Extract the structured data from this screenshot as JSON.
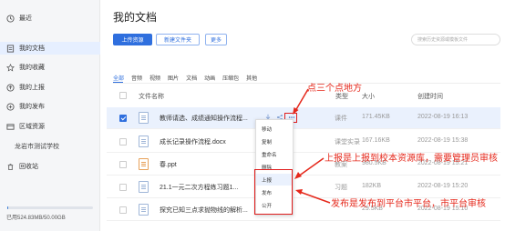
{
  "sidebar": {
    "items": [
      {
        "label": "最近",
        "icon": "clock-icon"
      },
      {
        "label": "我的文档",
        "icon": "document-icon"
      },
      {
        "label": "我的收藏",
        "icon": "star-icon"
      },
      {
        "label": "我的上报",
        "icon": "upload-report-icon"
      },
      {
        "label": "我的发布",
        "icon": "publish-icon"
      },
      {
        "label": "区域资源",
        "icon": "region-icon"
      },
      {
        "label": "龙岩市测试学校",
        "icon": ""
      },
      {
        "label": "回收站",
        "icon": "trash-icon"
      }
    ],
    "quota_text": "已用524.83MB/50.00GB",
    "quota_fraction": 0.0102
  },
  "main": {
    "title": "我的文档",
    "upload_button": "上传资源",
    "new_folder_button": "新建文件夹",
    "more_button": "更多",
    "search_placeholder": "搜索历史资源或模板文件",
    "tabs": [
      "全部",
      "音频",
      "视频",
      "图片",
      "文档",
      "动画",
      "压缩包",
      "其他"
    ],
    "headers": {
      "name": "文件名称",
      "type": "类型",
      "size": "大小",
      "created": "创建时间"
    },
    "rows": [
      {
        "name": "教师请选、成绩通知操作流程...",
        "type": "课件",
        "size": "171.45KB",
        "created": "2022-08-19 16:13",
        "selected": true,
        "icon": "doc"
      },
      {
        "name": "成长记录操作流程.docx",
        "type": "课堂实录",
        "size": "167.16KB",
        "created": "2022-08-19 15:38",
        "selected": false,
        "icon": "doc"
      },
      {
        "name": "春.ppt",
        "type": "教案",
        "size": "980.5KB",
        "created": "2022-08-19 15:21",
        "selected": false,
        "icon": "ppt"
      },
      {
        "name": "21.1一元二次方程练习题1...",
        "type": "习题",
        "size": "182KB",
        "created": "2022-08-19 15:20",
        "selected": false,
        "icon": "doc"
      },
      {
        "name": "探究已知三点求抛物线的解析...",
        "type": "",
        "size": "29.5KB",
        "created": "2022-08-19 15:10",
        "selected": false,
        "icon": "doc"
      }
    ]
  },
  "context_menu": {
    "items": [
      "移动",
      "复制",
      "重命名",
      "删除",
      "上报",
      "发布",
      "公开"
    ],
    "highlighted_index": 4
  },
  "annotations": {
    "dots": "点三个点地方",
    "report": "上报是上报到校本资源库，需要管理员审核",
    "publish": "发布是发布到平台市平台，市平台审核"
  },
  "colors": {
    "accent": "#2f6fde",
    "annotation": "#e5281b"
  }
}
